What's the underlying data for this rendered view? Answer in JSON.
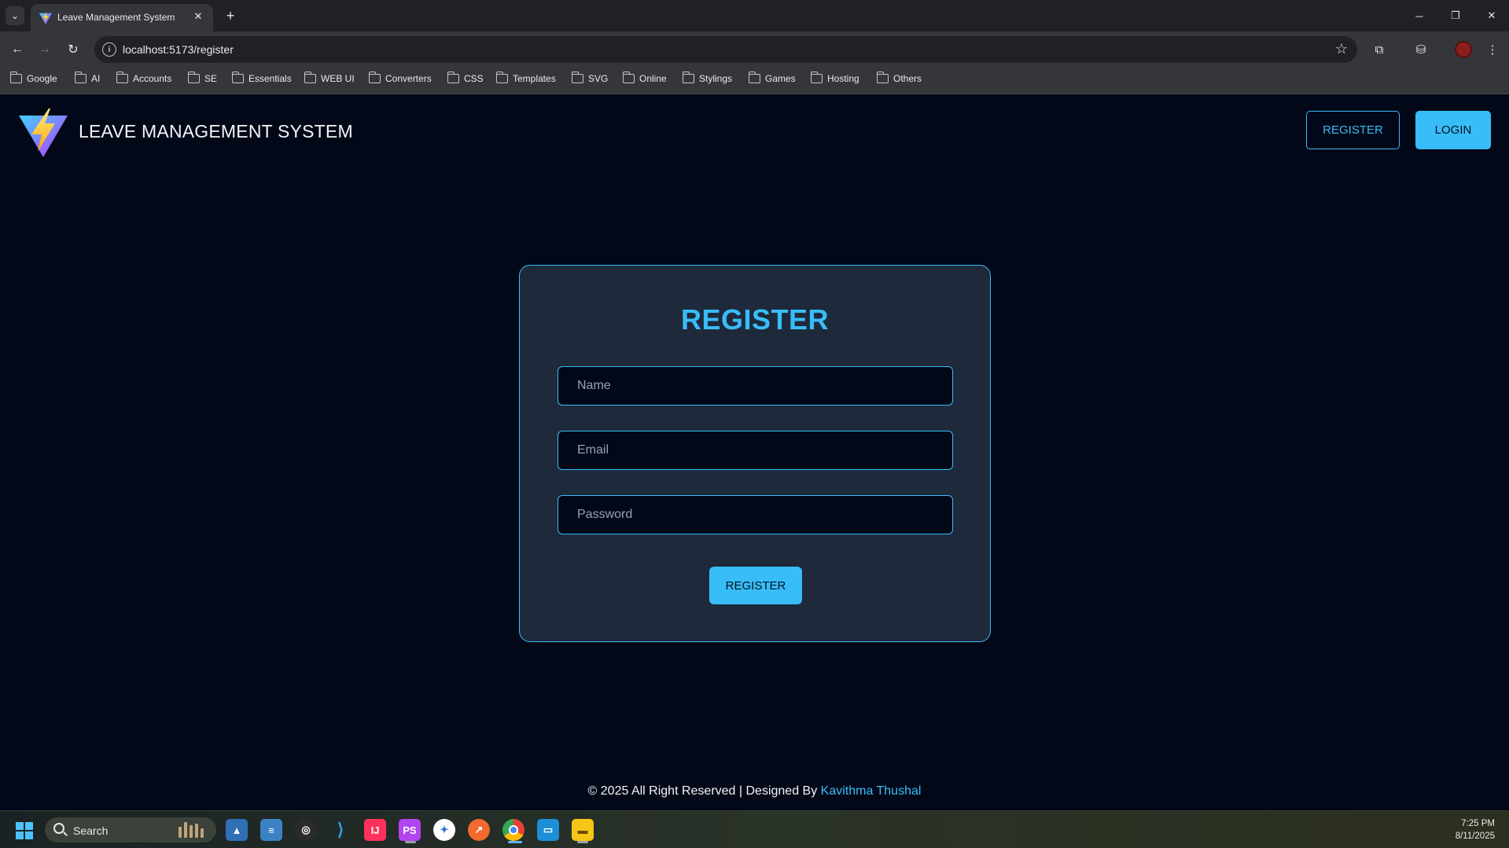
{
  "browser": {
    "tab_title": "Leave Management System",
    "tab_close_glyph": "✕",
    "new_tab_glyph": "+",
    "url": "localhost:5173/register",
    "bookmarks": [
      "Google",
      "AI",
      "Accounts",
      "SE",
      "Essentials",
      "WEB UI",
      "Converters",
      "CSS",
      "Templates",
      "SVG",
      "Online",
      "Stylings",
      "Games",
      "Hosting",
      "Others"
    ]
  },
  "header": {
    "brand": "LEAVE MANAGEMENT SYSTEM",
    "register_label": "REGISTER",
    "login_label": "LOGIN"
  },
  "form": {
    "title": "REGISTER",
    "name_placeholder": "Name",
    "email_placeholder": "Email",
    "password_placeholder": "Password",
    "submit_label": "REGISTER"
  },
  "footer": {
    "text": "© 2025 All Right Reserved | Designed By",
    "author": "Kavithma Thushal"
  },
  "taskbar": {
    "search_label": "Search",
    "time": "7:25 PM",
    "date": "8/11/2025"
  },
  "colors": {
    "page_bg": "#020817",
    "card_bg": "#1e293b",
    "accent": "#38bdf8"
  }
}
